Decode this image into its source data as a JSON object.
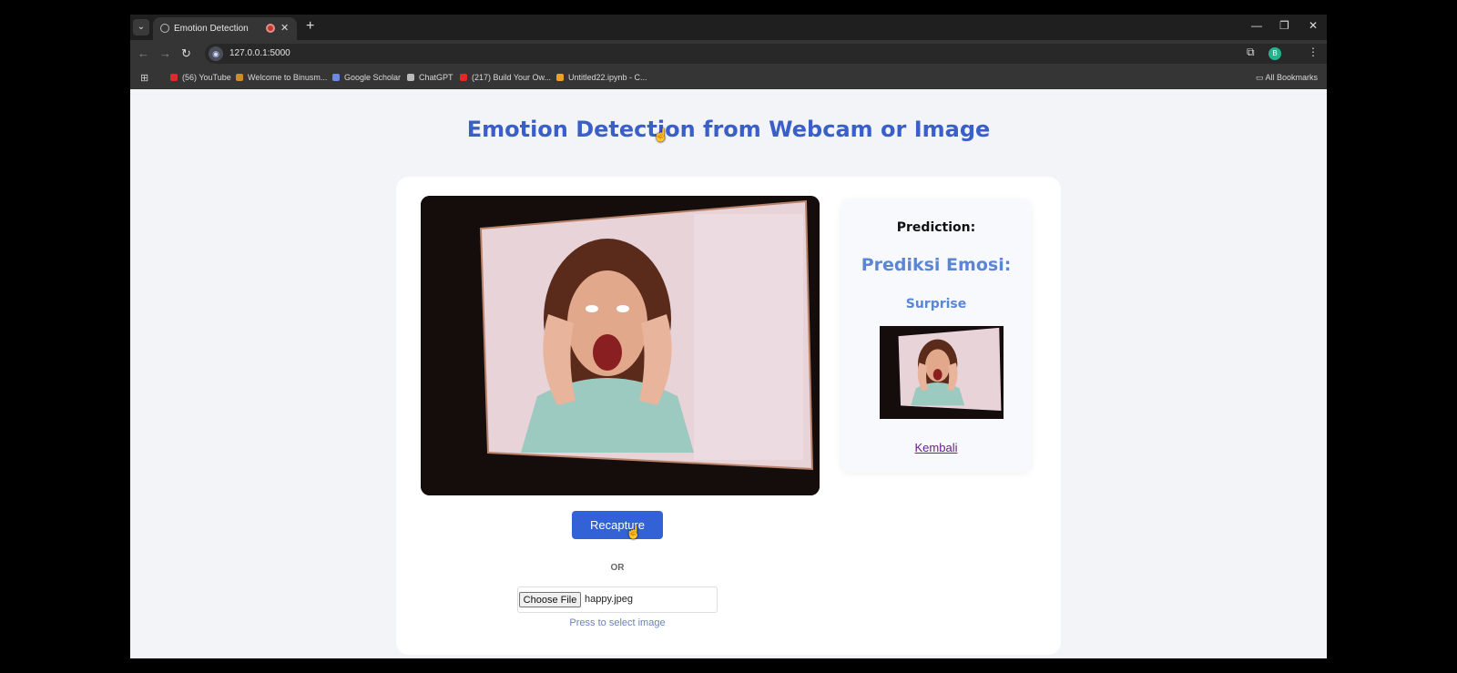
{
  "browser": {
    "tab_title": "Emotion Detection",
    "url": "127.0.0.1:5000",
    "profile_initial": "B",
    "bookmarks": [
      {
        "label": "(56) YouTube",
        "color": "#e02a2a"
      },
      {
        "label": "Welcome to Binusm...",
        "color": "#d08a2a"
      },
      {
        "label": "Google Scholar",
        "color": "#6b8be0"
      },
      {
        "label": "ChatGPT",
        "color": "#bbbbbb"
      },
      {
        "label": "(217) Build Your Ow...",
        "color": "#e02a2a"
      },
      {
        "label": "Untitled22.ipynb - C...",
        "color": "#f0a020"
      }
    ],
    "all_bookmarks": "All Bookmarks"
  },
  "page": {
    "title": "Emotion Detection from Webcam or Image",
    "recapture_label": "Recapture",
    "or_label": "OR",
    "choose_file_label": "Choose File",
    "file_name": "happy.jpeg",
    "file_hint": "Press to select image"
  },
  "prediction": {
    "heading": "Prediction:",
    "title": "Prediksi Emosi:",
    "value": "Surprise",
    "back_link": "Kembali"
  },
  "colors": {
    "accent": "#3b5fc8",
    "button": "#3262d6",
    "prediction": "#5b86d6"
  }
}
